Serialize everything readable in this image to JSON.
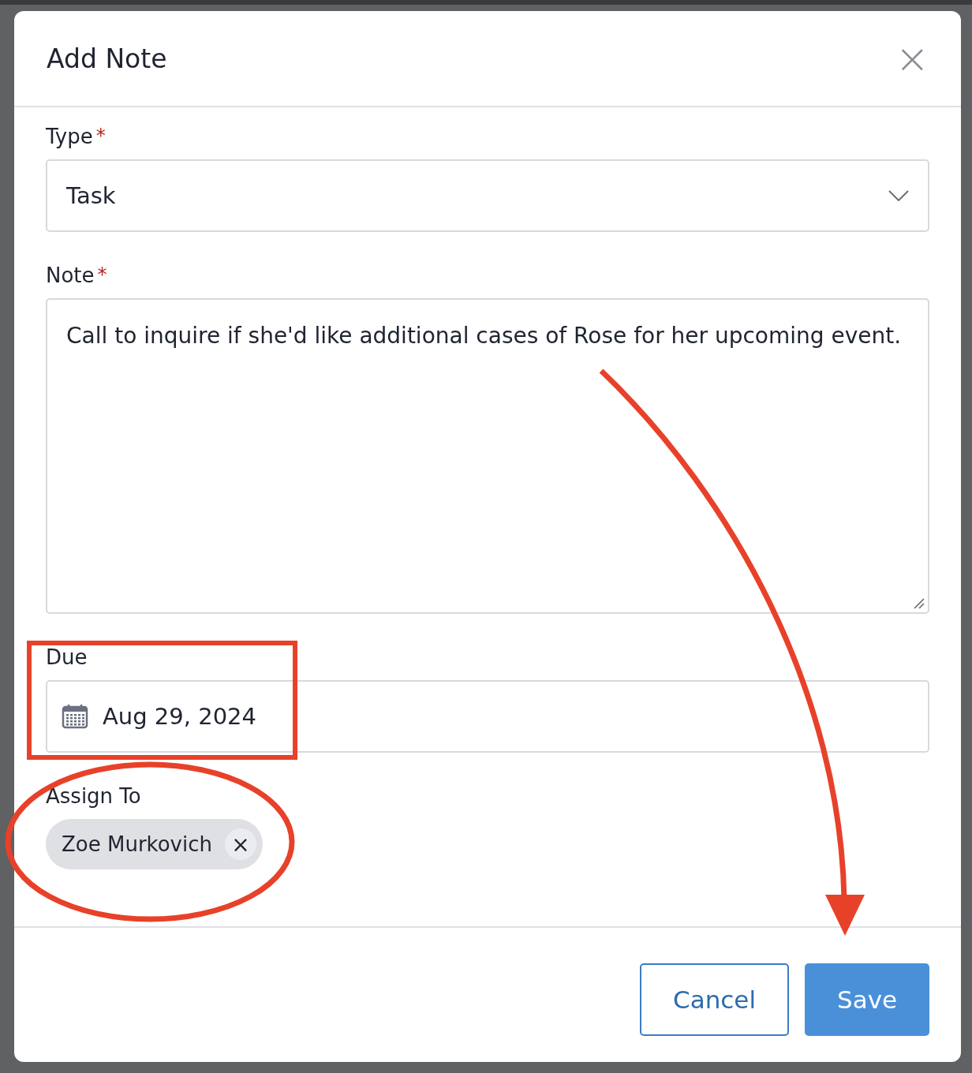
{
  "dialog": {
    "title": "Add Note",
    "close": "×"
  },
  "fields": [
    {
      "kind": "select",
      "label": "Type",
      "required_mark": "*",
      "value": "Task"
    },
    {
      "kind": "textarea",
      "label": "Note",
      "required_mark": "*",
      "value": "Call to inquire if she'd like additional cases of Rose for her upcoming event."
    },
    {
      "kind": "date",
      "label": "Due",
      "value": "Aug 29, 2024"
    },
    {
      "kind": "chips",
      "label": "Assign To",
      "chips": [
        {
          "label": "Zoe Murkovich",
          "remove": "×"
        }
      ]
    }
  ],
  "buttons": [
    {
      "label": "Cancel",
      "kind": "secondary"
    },
    {
      "label": "Save",
      "kind": "primary"
    }
  ]
}
